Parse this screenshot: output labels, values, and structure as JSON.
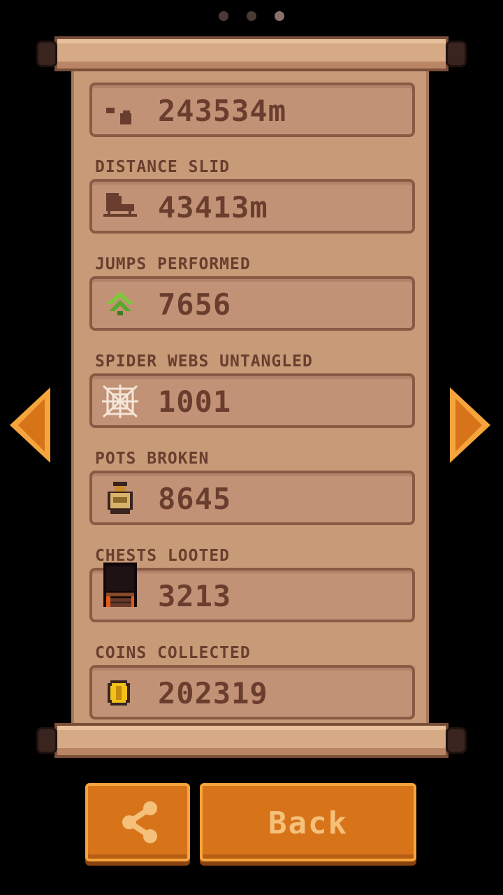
{
  "pager": {
    "pages": 3,
    "active": 3
  },
  "stats": [
    {
      "label": "",
      "value": "243534m",
      "icon": "distance-run-icon"
    },
    {
      "label": "DISTANCE SLID",
      "value": "43413m",
      "icon": "skate-boot-icon"
    },
    {
      "label": "JUMPS PERFORMED",
      "value": "7656",
      "icon": "jump-arrow-icon"
    },
    {
      "label": "SPIDER WEBS UNTANGLED",
      "value": "1001",
      "icon": "spider-web-icon"
    },
    {
      "label": "POTS BROKEN",
      "value": "8645",
      "icon": "pot-icon"
    },
    {
      "label": "CHESTS LOOTED",
      "value": "3213",
      "icon": "chest-icon"
    },
    {
      "label": "COINS COLLECTED",
      "value": "202319",
      "icon": "coin-icon"
    }
  ],
  "buttons": {
    "share_icon": "share-icon",
    "back_label": "Back"
  },
  "navigation": {
    "prev_icon": "left-arrow-icon",
    "next_icon": "right-arrow-icon"
  },
  "colors": {
    "parchment": "#c79a78",
    "text": "#6a3e2e",
    "button": "#d7741a",
    "arrow": "#f2a020"
  }
}
